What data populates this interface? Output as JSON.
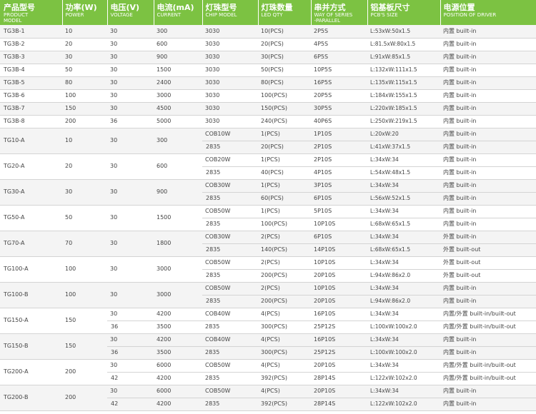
{
  "headers": [
    {
      "zh": "产品型号",
      "en": "PRODUCT\nMODEL"
    },
    {
      "zh": "功率(W)",
      "en": "POWER"
    },
    {
      "zh": "电压(V)",
      "en": "VOLTAGE"
    },
    {
      "zh": "电流(mA)",
      "en": "CURRENT"
    },
    {
      "zh": "灯珠型号",
      "en": "CHIP MODEL"
    },
    {
      "zh": "灯珠数量",
      "en": "LED QTY"
    },
    {
      "zh": "串并方式",
      "en": "WAY OF SERIES\n-PARALLEL"
    },
    {
      "zh": "铝基板尺寸",
      "en": "PCB'S SIZE"
    },
    {
      "zh": "电源位置",
      "en": "POSITION OF DRIVER"
    }
  ],
  "rows": [
    [
      "TG3B-1",
      "10",
      "30",
      "300",
      "3030",
      "10(PCS)",
      "2P5S",
      "L:53xW:50x1.5",
      "内置 built-in"
    ],
    [
      "TG3B-2",
      "20",
      "30",
      "600",
      "3030",
      "20(PCS)",
      "4P5S",
      "L:81.5xW:80x1.5",
      "内置 built-in"
    ],
    [
      "TG3B-3",
      "30",
      "30",
      "900",
      "3030",
      "30(PCS)",
      "6P5S",
      "L:91xW:85x1.5",
      "内置 built-in"
    ],
    [
      "TG3B-4",
      "50",
      "30",
      "1500",
      "3030",
      "50(PCS)",
      "10P5S",
      "L:132xW:111x1.5",
      "内置 built-in"
    ],
    [
      "TG3B-5",
      "80",
      "30",
      "2400",
      "3030",
      "80(PCS)",
      "16P5S",
      "L:135xW:115x1.5",
      "内置 built-in"
    ],
    [
      "TG3B-6",
      "100",
      "30",
      "3000",
      "3030",
      "100(PCS)",
      "20P5S",
      "L:184xW:155x1.5",
      "内置 built-in"
    ],
    [
      "TG3B-7",
      "150",
      "30",
      "4500",
      "3030",
      "150(PCS)",
      "30P5S",
      "L:220xW:185x1.5",
      "内置 built-in"
    ],
    [
      "TG3B-8",
      "200",
      "36",
      "5000",
      "3030",
      "240(PCS)",
      "40P6S",
      "L:250xW:219x1.5",
      "内置 built-in"
    ],
    [
      "TG10-A",
      "10",
      "30",
      "300",
      "COB10W",
      "1(PCS)",
      "1P10S",
      "L:20xW:20",
      "内置 built-in"
    ],
    [
      "",
      "",
      "",
      "",
      "2835",
      "20(PCS)",
      "2P10S",
      "L:41xW:37x1.5",
      "内置 built-in"
    ],
    [
      "TG20-A",
      "20",
      "30",
      "600",
      "COB20W",
      "1(PCS)",
      "2P10S",
      "L:34xW:34",
      "内置 built-in"
    ],
    [
      "",
      "",
      "",
      "",
      "2835",
      "40(PCS)",
      "4P10S",
      "L:54xW:48x1.5",
      "内置 built-in"
    ],
    [
      "TG30-A",
      "30",
      "30",
      "900",
      "COB30W",
      "1(PCS)",
      "3P10S",
      "L:34xW:34",
      "内置 built-in"
    ],
    [
      "",
      "",
      "",
      "",
      "2835",
      "60(PCS)",
      "6P10S",
      "L:56xW:52x1.5",
      "内置 built-in"
    ],
    [
      "TG50-A",
      "50",
      "30",
      "1500",
      "COB50W",
      "1(PCS)",
      "5P10S",
      "L:34xW:34",
      "内置 built-in"
    ],
    [
      "",
      "",
      "",
      "",
      "2835",
      "100(PCS)",
      "10P10S",
      "L:68xW:65x1.5",
      "内置 built-in"
    ],
    [
      "TG70-A",
      "70",
      "30",
      "1800",
      "COB30W",
      "2(PCS)",
      "6P10S",
      "L:34xW:34",
      "外置 built-in"
    ],
    [
      "",
      "",
      "",
      "",
      "2835",
      "140(PCS)",
      "14P10S",
      "L:68xW:65x1.5",
      "外置 built-out"
    ],
    [
      "TG100-A",
      "100",
      "30",
      "3000",
      "COB50W",
      "2(PCS)",
      "10P10S",
      "L:34xW:34",
      "外置 built-out"
    ],
    [
      "",
      "",
      "",
      "",
      "2835",
      "200(PCS)",
      "20P10S",
      "L:94xW:86x2.0",
      "外置 built-out"
    ],
    [
      "TG100-B",
      "100",
      "30",
      "3000",
      "COB50W",
      "2(PCS)",
      "10P10S",
      "L:34xW:34",
      "内置 built-in"
    ],
    [
      "",
      "",
      "",
      "",
      "2835",
      "200(PCS)",
      "20P10S",
      "L:94xW:86x2.0",
      "内置 built-in"
    ],
    [
      "TG150-A",
      "150",
      "30",
      "4200",
      "COB40W",
      "4(PCS)",
      "16P10S",
      "L:34xW:34",
      "内置/外置 built-in/built-out"
    ],
    [
      "",
      "",
      "36",
      "3500",
      "2835",
      "300(PCS)",
      "25P12S",
      "L:100xW:100x2.0",
      "内置/外置 built-in/built-out"
    ],
    [
      "TG150-B",
      "150",
      "30",
      "4200",
      "COB40W",
      "4(PCS)",
      "16P10S",
      "L:34xW:34",
      "内置 built-in"
    ],
    [
      "",
      "",
      "36",
      "3500",
      "2835",
      "300(PCS)",
      "25P12S",
      "L:100xW:100x2.0",
      "内置 built-in"
    ],
    [
      "TG200-A",
      "200",
      "30",
      "6000",
      "COB50W",
      "4(PCS)",
      "20P10S",
      "L:34xW:34",
      "内置/外置 built-in/built-out"
    ],
    [
      "",
      "",
      "42",
      "4200",
      "2835",
      "392(PCS)",
      "28P14S",
      "L:122xW:102x2.0",
      "内置/外置 built-in/built-out"
    ],
    [
      "TG200-B",
      "200",
      "30",
      "6000",
      "COB50W",
      "4(PCS)",
      "20P10S",
      "L:34xW:34",
      "内置 built-in"
    ],
    [
      "",
      "",
      "42",
      "4200",
      "2835",
      "392(PCS)",
      "28P14S",
      "L:122xW:102x2.0",
      "内置 built-in"
    ]
  ],
  "merged_rows": [
    8,
    10,
    12,
    14,
    16,
    18,
    20,
    22,
    24,
    26,
    28
  ],
  "theme": {
    "header_bg": "#7cc242",
    "header_text": "#ffffff",
    "cell_text": "#444444",
    "stripe": "#f4f4f4",
    "rule": "#d4d4d4"
  }
}
